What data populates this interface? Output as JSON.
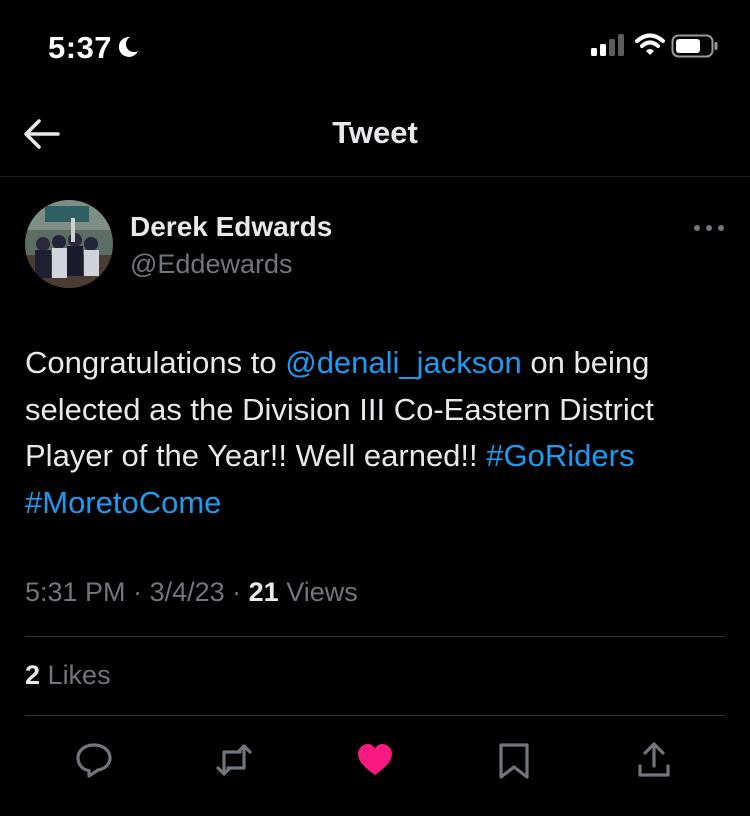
{
  "status_bar": {
    "time": "5:37",
    "icons": [
      "moon-icon",
      "signal-icon",
      "wifi-icon",
      "battery-icon"
    ]
  },
  "header": {
    "title": "Tweet",
    "back_icon": "back-arrow-icon"
  },
  "tweet": {
    "author_name": "Derek Edwards",
    "author_handle": "@Eddewards",
    "text": {
      "t1": "Congratulations to ",
      "mention": "@denali_jackson",
      "t2": " on being selected as the Division III Co-Eastern District Player of the Year!! Well earned!! ",
      "hashtag1": "#GoRiders",
      "hashtag2": "#MoretoCome"
    },
    "time": "5:31 PM",
    "date": "3/4/23",
    "views_count": "21",
    "views_label": "Views",
    "likes_count": "2",
    "likes_label": "Likes"
  },
  "actions": [
    {
      "icon": "reply-icon"
    },
    {
      "icon": "retweet-icon"
    },
    {
      "icon": "like-icon",
      "active": true
    },
    {
      "icon": "bookmark-icon"
    },
    {
      "icon": "share-icon"
    }
  ],
  "colors": {
    "background": "#000000",
    "text": "#e7e9ea",
    "secondary": "#71767b",
    "link": "#1d9bf0",
    "like": "#f91880"
  }
}
